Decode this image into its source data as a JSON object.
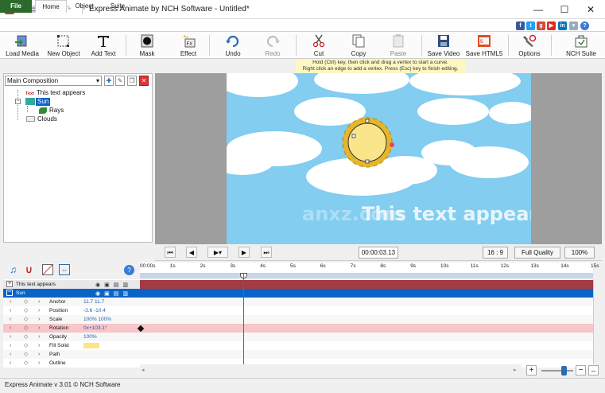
{
  "window": {
    "title": "Express Animate by NCH Software - Untitled*",
    "minimize": "—",
    "maximize": "☐",
    "close": "✕"
  },
  "menu": {
    "tabs": [
      "File",
      "Home",
      "Object",
      "Suite"
    ]
  },
  "help_label": "?",
  "ribbon": {
    "buttons": [
      {
        "label": "Load Media",
        "icon": "load-media-icon"
      },
      {
        "label": "New Object",
        "icon": "new-object-icon"
      },
      {
        "label": "Add Text",
        "icon": "add-text-icon"
      },
      {
        "label": "Mask",
        "icon": "mask-icon"
      },
      {
        "label": "Effect",
        "icon": "effect-icon"
      },
      {
        "label": "Undo",
        "icon": "undo-icon"
      },
      {
        "label": "Redo",
        "icon": "redo-icon"
      },
      {
        "label": "Cut",
        "icon": "cut-icon"
      },
      {
        "label": "Copy",
        "icon": "copy-icon"
      },
      {
        "label": "Paste",
        "icon": "paste-icon"
      },
      {
        "label": "Save Video",
        "icon": "save-video-icon"
      },
      {
        "label": "Save HTML5",
        "icon": "save-html5-icon"
      },
      {
        "label": "Options",
        "icon": "options-icon"
      },
      {
        "label": "NCH Suite",
        "icon": "nch-suite-icon"
      }
    ]
  },
  "hint": {
    "line1": "Hold (Ctrl) key, then click and drag a vertex to start a curve.",
    "line2": "Right click an edge to add a vertex. Press (Esc) key to finish editing."
  },
  "composition": {
    "selected": "Main Composition",
    "tree": [
      "This text appears",
      "Sun",
      "Rays",
      "Clouds"
    ],
    "text_badge": "Text"
  },
  "stage": {
    "overlay_text": "This text appears",
    "sky_color": "#82cdf0",
    "sun_color": "#fae58a",
    "watermark_text": "anxz.com"
  },
  "player": {
    "time": "00:00:03.13",
    "aspect": "16 : 9",
    "quality": "Full Quality",
    "zoom": "100%"
  },
  "timeline": {
    "ticks": [
      "00:00s",
      "1s",
      "2s",
      "3s",
      "4s",
      "5s",
      "6s",
      "7s",
      "8s",
      "9s",
      "10s",
      "11s",
      "12s",
      "13s",
      "14s",
      "15s"
    ],
    "layers": [
      "This text appears",
      "Sun"
    ],
    "properties": [
      {
        "name": "Anchor",
        "value": "11.7  11.7"
      },
      {
        "name": "Position",
        "value": "-3.6  -10.4"
      },
      {
        "name": "Scale",
        "value": "100%  100%"
      },
      {
        "name": "Rotation",
        "value": "0x+103.1°"
      },
      {
        "name": "Opacity",
        "value": "100%"
      },
      {
        "name": "Fill Solid",
        "value": ""
      },
      {
        "name": "Path",
        "value": ""
      },
      {
        "name": "Outline",
        "value": ""
      }
    ]
  },
  "status": "Express Animate v 3.01 © NCH Software"
}
